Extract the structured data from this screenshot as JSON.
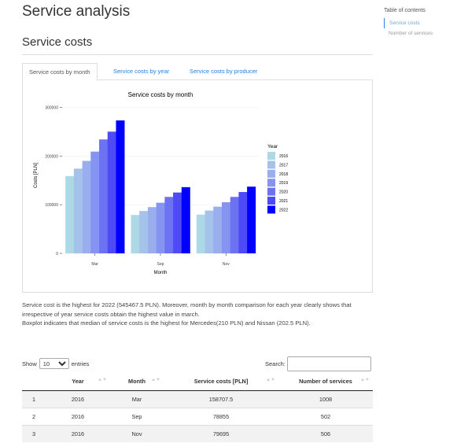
{
  "page": {
    "title": "Service analysis"
  },
  "section": {
    "title": "Service costs"
  },
  "toc": {
    "title": "Table of contents",
    "items": [
      {
        "label": "Service costs",
        "active": true
      },
      {
        "label": "Number of services",
        "active": false
      }
    ]
  },
  "tabs": [
    {
      "label": "Service costs by month",
      "active": true
    },
    {
      "label": "Service costs by year",
      "active": false
    },
    {
      "label": "Service costs by producer",
      "active": false
    }
  ],
  "colors": {
    "link": "#2780e3"
  },
  "chart_data": {
    "type": "bar",
    "title": "Service costs by month",
    "xlabel": "Month",
    "ylabel": "Costs [PLN]",
    "categories": [
      "Mar",
      "Sep",
      "Nov"
    ],
    "ylim": [
      0,
      320000
    ],
    "yticks": [
      0,
      100000,
      200000,
      300000
    ],
    "legend": {
      "title": "Year",
      "placement": "right"
    },
    "grid": true,
    "series": [
      {
        "name": "2016",
        "color": "#add8e6",
        "values": [
          158707.5,
          78855,
          79695
        ]
      },
      {
        "name": "2017",
        "color": "#a5c3ea",
        "values": [
          174000,
          87000,
          88000
        ]
      },
      {
        "name": "2018",
        "color": "#9aaeee",
        "values": [
          190000,
          95000,
          96000
        ]
      },
      {
        "name": "2019",
        "color": "#8594f0",
        "values": [
          209000,
          104000,
          105000
        ]
      },
      {
        "name": "2020",
        "color": "#6d72f3",
        "values": [
          234000,
          116000,
          116000
        ]
      },
      {
        "name": "2021",
        "color": "#4e4af8",
        "values": [
          250000,
          125000,
          126000
        ]
      },
      {
        "name": "2022",
        "color": "#0000ff",
        "values": [
          273000,
          136000,
          137000
        ]
      }
    ]
  },
  "description": {
    "line1": "Service cost is the highest for 2022 (545467.5 PLN). Moreover, month by month comparison for each year clearly shows that irrespective of year service costs obtain the highest value in march.",
    "line2": "Boxplot indicates that median of service costs is the highest for Mercedes(210 PLN) and Nissan (202.5 PLN)."
  },
  "datatable": {
    "show_label": "Show",
    "length_value": "10",
    "entries_label": "entries",
    "search_label": "Search:",
    "search_value": "",
    "columns": [
      "",
      "Year",
      "Month",
      "Service costs [PLN]",
      "Number of services"
    ],
    "rows": [
      [
        "1",
        "2016",
        "Mar",
        "158707.5",
        "1008"
      ],
      [
        "2",
        "2016",
        "Sep",
        "78855",
        "502"
      ],
      [
        "3",
        "2016",
        "Nov",
        "79695",
        "506"
      ]
    ]
  }
}
